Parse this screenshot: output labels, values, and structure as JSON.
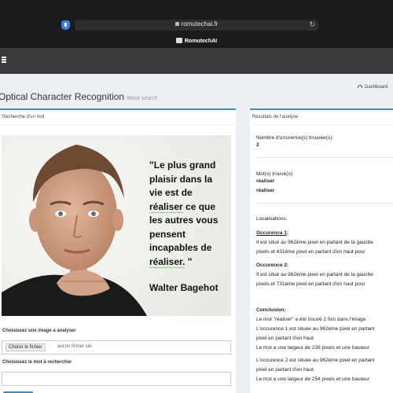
{
  "browser": {
    "url": "romutechai.fr",
    "tab_title": "RomutechAI"
  },
  "page": {
    "title": "Optical Character Recognition",
    "subtitle": "Word search",
    "breadcrumb": "Dashboard"
  },
  "left_panel": {
    "header": "Recherche d'un mot",
    "quote_lines": [
      "\"Le plus grand",
      "plaisir dans la",
      "vie est de"
    ],
    "quote_word_1": "réaliser",
    "quote_line_4_rest": " ce que",
    "quote_lines_b": [
      "les autres vous",
      "pensent",
      "incapables de"
    ],
    "quote_word_2": "réaliser.",
    "quote_end": " \"",
    "quote_author": "Walter Bagehot",
    "image_label": "Choisissez une image à analyser",
    "file_button": "Choisir le fichier",
    "file_status": "aucun fichier sél.",
    "word_label": "Choisissez le mot à rechercher",
    "word_value": ""
  },
  "right_panel": {
    "header": "Résultats de l'analyse",
    "occ_count_label": "Nombre d'orrurence(s) trouvée(s):",
    "occ_count": "2",
    "words_label": "Mot(s) trouvé(s):",
    "words": [
      "réaliser",
      "réaliser"
    ],
    "locations_label": "Localisations:",
    "occ1_title": "Occurence 1",
    "occ1_colon": ":",
    "occ1_line1": "Il est situé au 962ème pixel en partant de la gauche",
    "occ1_line2": "pixels et 431ème pixel en partant d'en haut pour",
    "occ2_title": "Occurence 2:",
    "occ2_line1": "Il est situé au 962ème pixel en partant de la gauche",
    "occ2_line2": "pixels et 731ème pixel en partant d'en haut pour",
    "conclusion_title": "Conclusion:",
    "conclusion_lines": [
      "Le mot \"réaliser\" a été trouvé 2 fois dans l'image",
      "L'occurence 1 est située au 962ème pixel en partant",
      "pixel en partant d'en haut.",
      "Le mot a une largeur de 239 pixels et une hauteur"
    ],
    "conclusion_lines_2": [
      "L'occurence 2 est située au 962ème pixel en partant",
      "pixel en partant d'en haut.",
      "Le mot a une largeur de 254 pixels et une hauteur"
    ]
  }
}
